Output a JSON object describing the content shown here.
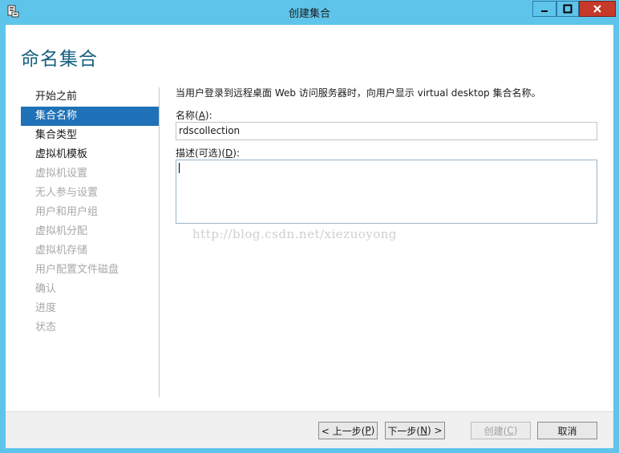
{
  "window": {
    "title": "创建集合",
    "icon": "server-manager-icon"
  },
  "page": {
    "heading": "命名集合"
  },
  "nav": {
    "items": [
      {
        "label": "开始之前",
        "state": "normal"
      },
      {
        "label": "集合名称",
        "state": "active"
      },
      {
        "label": "集合类型",
        "state": "normal"
      },
      {
        "label": "虚拟机模板",
        "state": "normal"
      },
      {
        "label": "虚拟机设置",
        "state": "disabled"
      },
      {
        "label": "无人参与设置",
        "state": "disabled"
      },
      {
        "label": "用户和用户组",
        "state": "disabled"
      },
      {
        "label": "虚拟机分配",
        "state": "disabled"
      },
      {
        "label": "虚拟机存储",
        "state": "disabled"
      },
      {
        "label": "用户配置文件磁盘",
        "state": "disabled"
      },
      {
        "label": "确认",
        "state": "disabled"
      },
      {
        "label": "进度",
        "state": "disabled"
      },
      {
        "label": "状态",
        "state": "disabled"
      }
    ]
  },
  "form": {
    "description": "当用户登录到远程桌面 Web 访问服务器时，向用户显示 virtual desktop 集合名称。",
    "name_label": "名称(",
    "name_hotkey": "A",
    "name_label_end": "):",
    "name_value": "rdscollection",
    "desc_label": "描述(可选)(",
    "desc_hotkey": "D",
    "desc_label_end": "):",
    "desc_value": ""
  },
  "watermark": "http://blog.csdn.net/xiezuoyong",
  "buttons": {
    "prev_label": "< 上一步(",
    "prev_hotkey": "P",
    "prev_end": ")",
    "next_label": "下一步(",
    "next_hotkey": "N",
    "next_end": ") >",
    "create_label": "创建(",
    "create_hotkey": "C",
    "create_end": ")",
    "cancel_label": "取消"
  },
  "colors": {
    "title_bar": "#5fc4ea",
    "close_button": "#c7392b",
    "heading": "#16607e",
    "nav_active": "#1f72b7",
    "nav_disabled_text": "#a8a8a8"
  }
}
